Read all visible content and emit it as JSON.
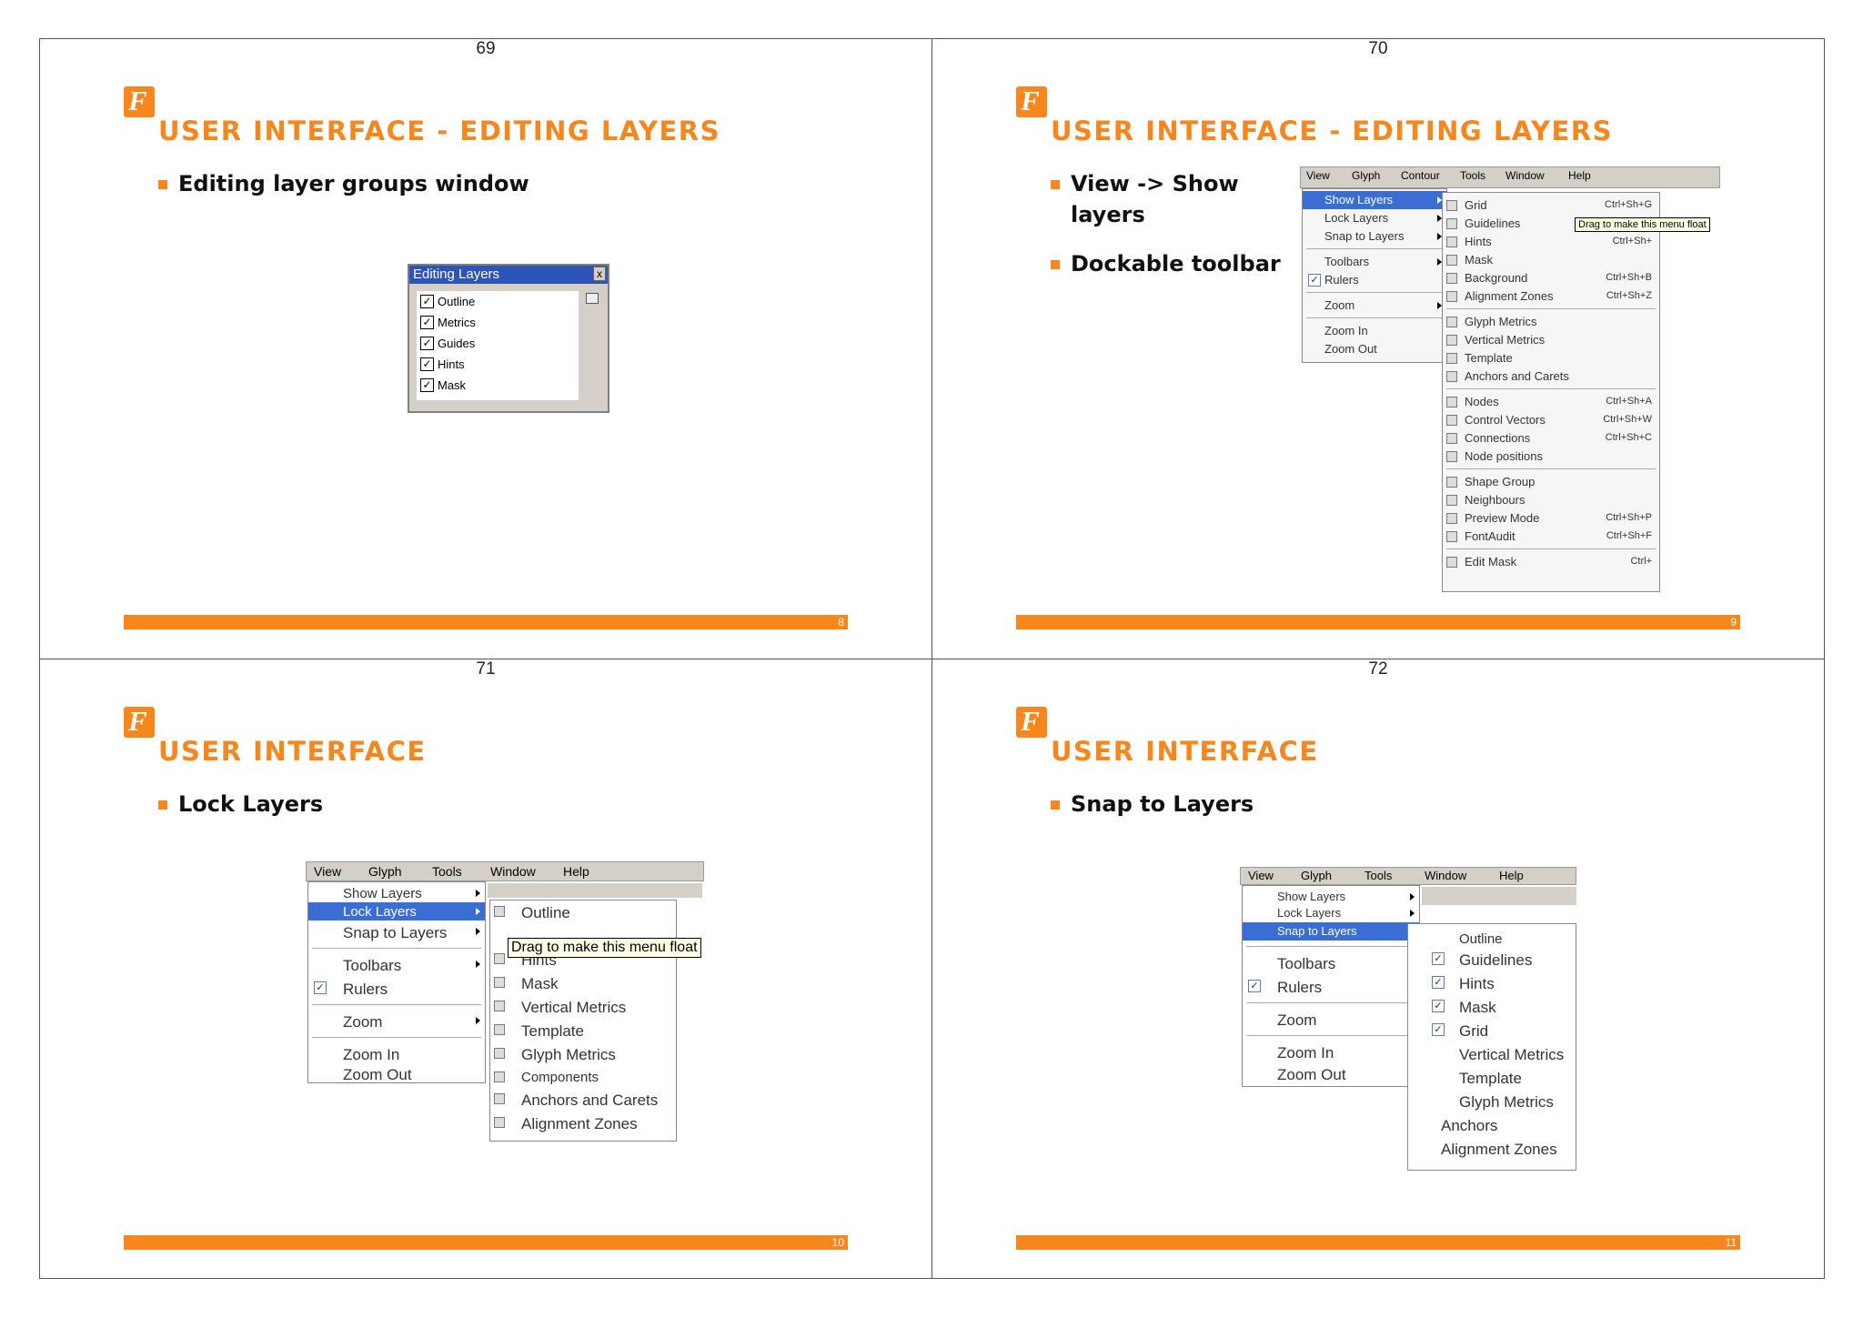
{
  "slides": [
    {
      "page": "69",
      "title": "USER INTERFACE - EDITING LAYERS",
      "bullets": [
        "Editing layer groups window"
      ],
      "footer_num": "8",
      "window": {
        "title": "Editing Layers",
        "close": "x",
        "items": [
          "Outline",
          "Metrics",
          "Guides",
          "Hints",
          "Mask"
        ]
      }
    },
    {
      "page": "70",
      "title": "USER INTERFACE - EDITING LAYERS",
      "bullets": [
        "View -> Show layers",
        "Dockable toolbar"
      ],
      "footer_num": "9",
      "menubar": [
        "View",
        "Glyph",
        "Contour",
        "Tools",
        "Window",
        "Help"
      ],
      "view_menu": [
        "Show Layers",
        "Lock Layers",
        "Snap to Layers",
        "Toolbars",
        "Rulers",
        "Zoom",
        "Zoom In",
        "Zoom Out"
      ],
      "submenu": [
        {
          "label": "Grid",
          "shortcut": "Ctrl+Sh+G"
        },
        {
          "label": "Guidelines",
          "shortcut": ""
        },
        {
          "label": "Hints",
          "shortcut": "Ctrl+Sh+"
        },
        {
          "label": "Mask",
          "shortcut": ""
        },
        {
          "label": "Background",
          "shortcut": "Ctrl+Sh+B"
        },
        {
          "label": "Alignment Zones",
          "shortcut": "Ctrl+Sh+Z"
        },
        {
          "label": "Glyph Metrics",
          "shortcut": ""
        },
        {
          "label": "Vertical Metrics",
          "shortcut": ""
        },
        {
          "label": "Template",
          "shortcut": ""
        },
        {
          "label": "Anchors and Carets",
          "shortcut": ""
        },
        {
          "label": "Nodes",
          "shortcut": "Ctrl+Sh+A"
        },
        {
          "label": "Control Vectors",
          "shortcut": "Ctrl+Sh+W"
        },
        {
          "label": "Connections",
          "shortcut": "Ctrl+Sh+C"
        },
        {
          "label": "Node positions",
          "shortcut": ""
        },
        {
          "label": "Shape Group",
          "shortcut": ""
        },
        {
          "label": "Neighbours",
          "shortcut": ""
        },
        {
          "label": "Preview Mode",
          "shortcut": "Ctrl+Sh+P"
        },
        {
          "label": "FontAudit",
          "shortcut": "Ctrl+Sh+F"
        },
        {
          "label": "Edit Mask",
          "shortcut": "Ctrl+"
        }
      ],
      "tooltip": "Drag to make this menu float"
    },
    {
      "page": "71",
      "title": "USER INTERFACE",
      "bullets": [
        "Lock Layers"
      ],
      "footer_num": "10",
      "menubar": [
        "View",
        "Glyph",
        "Tools",
        "Window",
        "Help"
      ],
      "view_menu": [
        "Show Layers",
        "Lock Layers",
        "Snap to Layers",
        "Toolbars",
        "Rulers",
        "Zoom",
        "Zoom In",
        "Zoom Out"
      ],
      "submenu": [
        "Outline",
        "",
        "Hints",
        "Mask",
        "Vertical Metrics",
        "Template",
        "Glyph Metrics",
        "Components",
        "Anchors and Carets",
        "Alignment Zones"
      ],
      "tooltip": "Drag to make this menu float"
    },
    {
      "page": "72",
      "title": "USER INTERFACE",
      "bullets": [
        "Snap to Layers"
      ],
      "footer_num": "11",
      "menubar": [
        "View",
        "Glyph",
        "Tools",
        "Window",
        "Help"
      ],
      "view_menu": [
        "Show Layers",
        "Lock Layers",
        "Snap to Layers",
        "Toolbars",
        "Rulers",
        "Zoom",
        "Zoom In",
        "Zoom Out"
      ],
      "submenu": [
        "Outline",
        "Guidelines",
        "Hints",
        "Mask",
        "Grid",
        "Vertical Metrics",
        "Template",
        "Glyph Metrics",
        "Anchors",
        "Alignment Zones"
      ]
    }
  ],
  "colors": {
    "accent": "#f7861d",
    "menu_highlight": "#3a6ed4",
    "menu_bg": "#d4d0c8"
  }
}
